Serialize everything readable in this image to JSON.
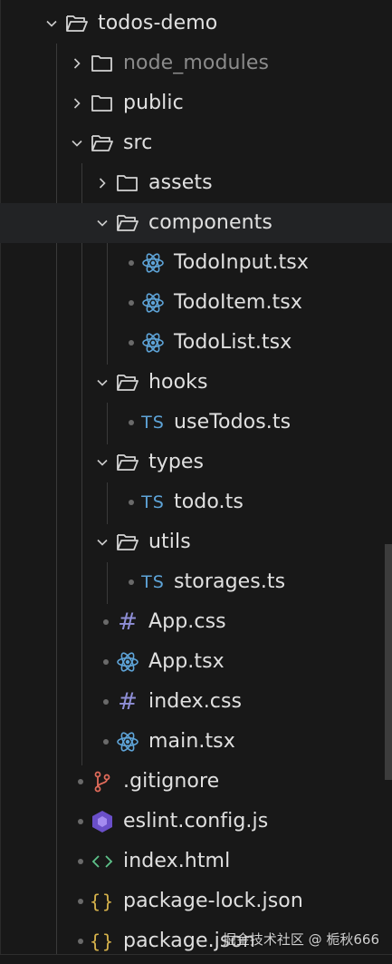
{
  "explorer": {
    "root": {
      "label": "todos-demo",
      "icon": "folder-open-icon",
      "expanded": true
    },
    "items": [
      {
        "label": "node_modules",
        "icon": "folder-icon",
        "expanded": false,
        "dimmed": true
      },
      {
        "label": "public",
        "icon": "folder-icon",
        "expanded": false
      },
      {
        "label": "src",
        "icon": "folder-open-icon",
        "expanded": true
      },
      {
        "label": "assets",
        "icon": "folder-icon",
        "expanded": false
      },
      {
        "label": "components",
        "icon": "folder-open-icon",
        "expanded": true,
        "hovered": true
      },
      {
        "label": "TodoInput.tsx",
        "icon": "react-icon"
      },
      {
        "label": "TodoItem.tsx",
        "icon": "react-icon"
      },
      {
        "label": "TodoList.tsx",
        "icon": "react-icon"
      },
      {
        "label": "hooks",
        "icon": "folder-open-icon",
        "expanded": true
      },
      {
        "label": "useTodos.ts",
        "icon": "typescript-icon",
        "icon_text": "TS"
      },
      {
        "label": "types",
        "icon": "folder-open-icon",
        "expanded": true
      },
      {
        "label": "todo.ts",
        "icon": "typescript-icon",
        "icon_text": "TS"
      },
      {
        "label": "utils",
        "icon": "folder-open-icon",
        "expanded": true
      },
      {
        "label": "storages.ts",
        "icon": "typescript-icon",
        "icon_text": "TS"
      },
      {
        "label": "App.css",
        "icon": "css-icon",
        "icon_text": "#"
      },
      {
        "label": "App.tsx",
        "icon": "react-icon"
      },
      {
        "label": "index.css",
        "icon": "css-icon",
        "icon_text": "#"
      },
      {
        "label": "main.tsx",
        "icon": "react-icon"
      },
      {
        "label": ".gitignore",
        "icon": "git-icon"
      },
      {
        "label": "eslint.config.js",
        "icon": "eslint-icon"
      },
      {
        "label": "index.html",
        "icon": "html-icon",
        "icon_text": "<>"
      },
      {
        "label": "package-lock.json",
        "icon": "json-icon",
        "icon_text": "{}"
      },
      {
        "label": "package.json",
        "icon": "json-icon",
        "icon_text": "{}"
      }
    ]
  },
  "watermark": {
    "text": "掘金技术社区 @ 栀秋666"
  },
  "colors": {
    "background": "#181818",
    "text": "#e0e0e0",
    "dim_text": "#8b8b8b",
    "react": "#5ea4d8",
    "typescript": "#5ea4d8",
    "css": "#8e8ed6",
    "git": "#e06b5a",
    "eslint": "#7c5cd6",
    "html": "#5ec28a",
    "json": "#d6b24b"
  }
}
